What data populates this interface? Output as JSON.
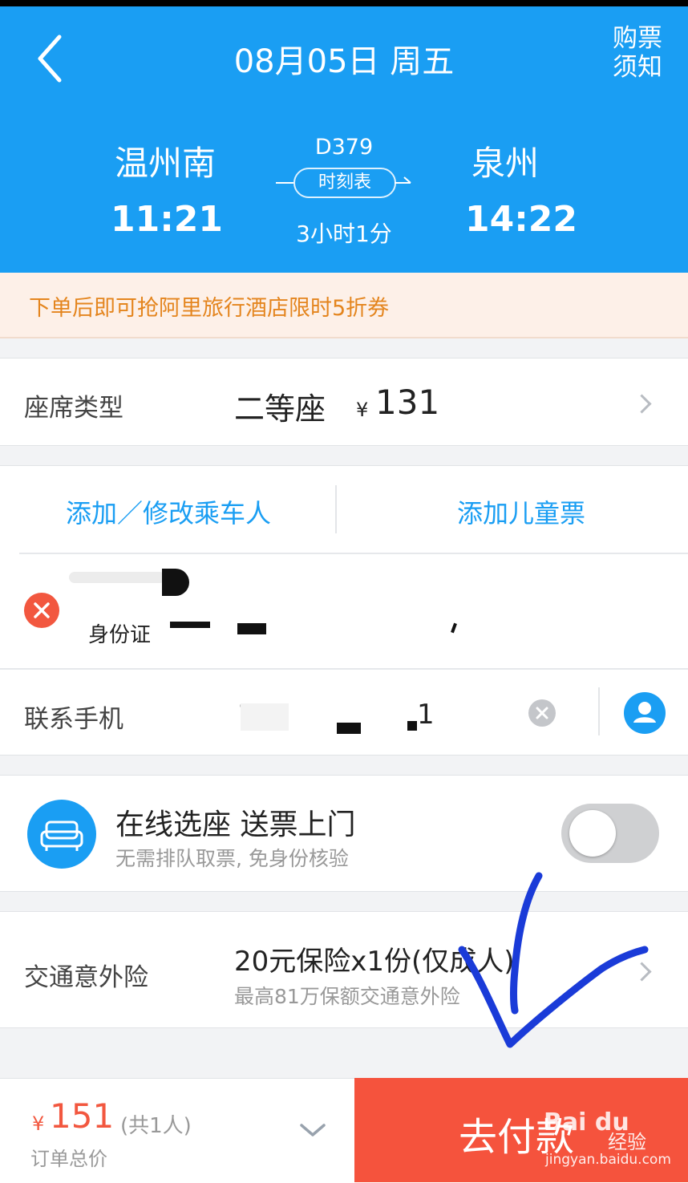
{
  "header": {
    "title": "08月05日 周五",
    "notice": [
      "购票",
      "须知"
    ],
    "from_station": "温州南",
    "depart_time": "11:21",
    "train_no": "D379",
    "timetable_label": "时刻表",
    "duration": "3小时1分",
    "to_station": "泉州",
    "arrive_time": "14:22",
    "bg_color": "#1a9ef3"
  },
  "promo": {
    "text": "下单后即可抢阿里旅行酒店限时5折券"
  },
  "seat": {
    "label": "座席类型",
    "value": "二等座",
    "currency": "¥",
    "price": "131"
  },
  "passengers": {
    "add_edit": "添加／修改乘车人",
    "add_child": "添加儿童票",
    "items": [
      {
        "id_type": "身份证"
      }
    ]
  },
  "contact": {
    "label": "联系手机",
    "phone_partial": [
      "1",
      "1"
    ]
  },
  "seat_service": {
    "title": "在线选座 送票上门",
    "subtitle": "无需排队取票, 免身份核验",
    "enabled": false
  },
  "insurance": {
    "label": "交通意外险",
    "title": "20元保险x1份(仅成人)",
    "subtitle": "最高81万保额交通意外险"
  },
  "footer": {
    "currency": "¥",
    "total": "151",
    "count": "(共1人)",
    "total_label": "订单总价",
    "pay_label": "去付款",
    "pay_color": "#f5533d"
  },
  "watermark": {
    "brand": "Bai du",
    "suffix": "经验",
    "url": "jingyan.baidu.com"
  }
}
